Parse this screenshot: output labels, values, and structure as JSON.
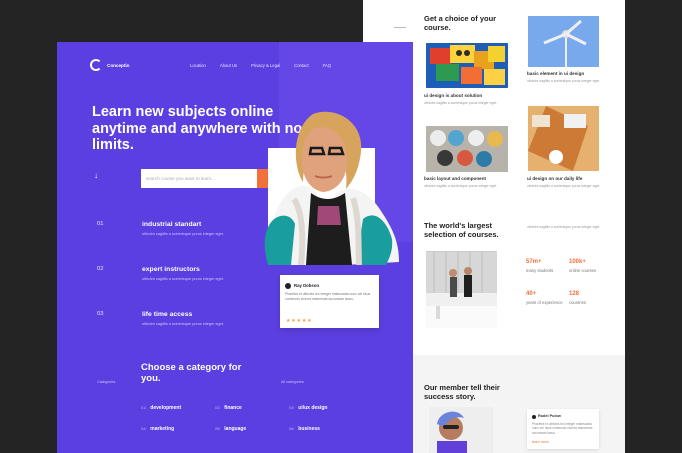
{
  "colors": {
    "background": "#242424",
    "primary": "#5b3fe0",
    "accent": "#f2703a",
    "white_page": "#ffffff"
  },
  "main": {
    "logo_text": "Conceptin",
    "nav": [
      "Location",
      "About Us",
      "Privacy & Legal",
      "Contact",
      "FAQ"
    ],
    "headline": "Learn new subjects online anytime and anywhere with no limits.",
    "search": {
      "placeholder": "search course you want to learn...",
      "button_label": "search"
    },
    "features": [
      {
        "number": "01",
        "title": "industrial standart",
        "description": "ultricies sagittis a scelerisque purus integer eget."
      },
      {
        "number": "02",
        "title": "expert instructors",
        "description": "ultricies sagittis a scelerisque purus integer eget."
      },
      {
        "number": "03",
        "title": "life time access",
        "description": "ultricies sagittis a scelerisque purus integer eget."
      }
    ],
    "testimonial": {
      "name": "Ray Dobson",
      "quote": "Pharetra et ultricies leo integer malesuada nunc vel risus commodo viverra maecenas accumsan lacus.",
      "rating": 5,
      "stars": "★★★★★"
    },
    "category": {
      "left_label": "Categories",
      "title": "Choose a category for you.",
      "all_link": "All categories",
      "items": [
        {
          "number": "01/",
          "label": "development"
        },
        {
          "number": "02/",
          "label": "finance"
        },
        {
          "number": "03/",
          "label": "ui/ux design"
        },
        {
          "number": "04/",
          "label": "marketing"
        },
        {
          "number": "05/",
          "label": "language"
        },
        {
          "number": "06/",
          "label": "business"
        }
      ]
    }
  },
  "back": {
    "choice_title": "Get a choice of your course.",
    "course_cards": [
      {
        "caption": "ui design is about solution",
        "description": "ultricies sagittis a scelerisque purus integer eget."
      },
      {
        "caption": "basic element in ui design",
        "description": "ultricies sagittis a scelerisque purus integer eget."
      },
      {
        "caption": "basic layout and component",
        "description": "ultricies sagittis a scelerisque purus integer eget."
      },
      {
        "caption": "ui design on our daily life",
        "description": "ultricies sagittis a scelerisque purus integer eget."
      }
    ],
    "world_title": "The world's largest selection of courses.",
    "world_description": "ultricies sagittis a scelerisque purus integer eget.",
    "stats": [
      {
        "value": "57m+",
        "label": "many students"
      },
      {
        "value": "100k+",
        "label": "online courses"
      },
      {
        "value": "40+",
        "label": "years of experience"
      },
      {
        "value": "128",
        "label": "countries"
      }
    ],
    "member_title": "Our member tell their success story.",
    "member_card_name": "Rodel Pulow",
    "member_card_text": "Pharetra et ultricies leo integer malesuada nunc vel risus commodo viverra maecenas accumsan lacus.",
    "member_card_link": "learn more"
  }
}
